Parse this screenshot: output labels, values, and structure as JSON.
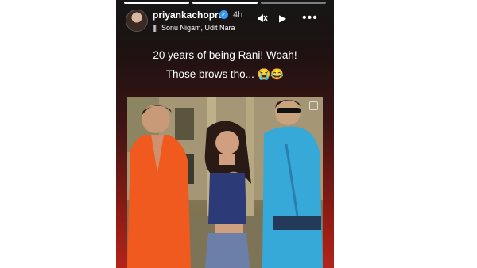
{
  "story": {
    "username": "priyankachopra",
    "time": "4h",
    "music": "Sonu Nigam, Udit Nara",
    "caption_line1": "20 years of being Rani! Woah!",
    "caption_line2": "Those brows tho... 😭😂",
    "icons": [
      "mute-icon",
      "play-icon",
      "more-icon",
      "verified-badge-icon",
      "music-icon"
    ]
  }
}
